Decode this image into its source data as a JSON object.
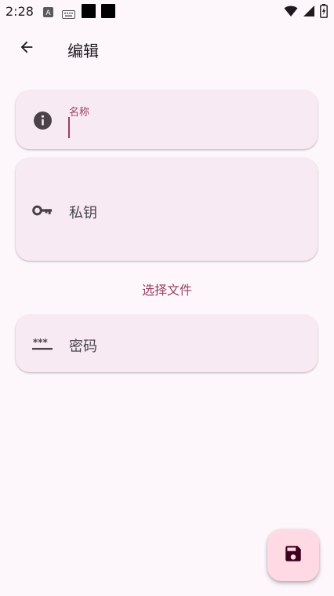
{
  "status_bar": {
    "time": "2:28",
    "icons": [
      "a-box-icon",
      "keyboard-icon",
      "black-square-icon",
      "black-square-icon",
      "wifi-icon",
      "signal-icon",
      "battery-charging-icon"
    ]
  },
  "app_bar": {
    "title": "编辑",
    "back_icon": "arrow-back-icon"
  },
  "form": {
    "name_field": {
      "label": "名称",
      "value": "",
      "icon": "info-icon"
    },
    "private_key_field": {
      "label": "私钥",
      "icon": "key-icon"
    },
    "select_file_label": "选择文件",
    "password_field": {
      "label": "密码",
      "icon": "password-icon"
    }
  },
  "fab": {
    "icon": "save-icon"
  },
  "colors": {
    "background": "#fdf7fb",
    "card": "#f8eaf3",
    "accent": "#984061",
    "fab": "#ffd9e3",
    "icon": "#4b4148"
  }
}
